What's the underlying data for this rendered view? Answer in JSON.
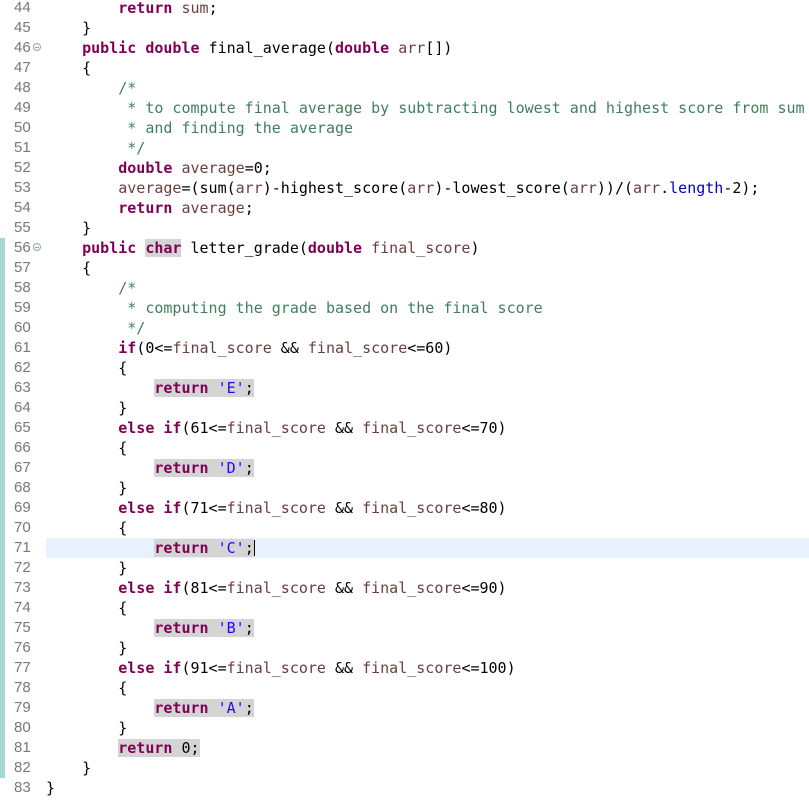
{
  "editor": {
    "lines": [
      {
        "num": "44",
        "tokens": [
          {
            "t": "        "
          },
          {
            "t": "return",
            "c": "kw"
          },
          {
            "t": " "
          },
          {
            "t": "sum",
            "c": "id"
          },
          {
            "t": ";"
          }
        ]
      },
      {
        "num": "45",
        "tokens": [
          {
            "t": "    }"
          }
        ]
      },
      {
        "num": "46",
        "fold": true,
        "tokens": [
          {
            "t": "    "
          },
          {
            "t": "public",
            "c": "kw"
          },
          {
            "t": " "
          },
          {
            "t": "double",
            "c": "kw"
          },
          {
            "t": " final_average("
          },
          {
            "t": "double",
            "c": "kw"
          },
          {
            "t": " "
          },
          {
            "t": "arr",
            "c": "id"
          },
          {
            "t": "[])"
          }
        ]
      },
      {
        "num": "47",
        "tokens": [
          {
            "t": "    {"
          }
        ]
      },
      {
        "num": "48",
        "tokens": [
          {
            "t": "        "
          },
          {
            "t": "/*",
            "c": "cmt"
          }
        ]
      },
      {
        "num": "49",
        "tokens": [
          {
            "t": "         "
          },
          {
            "t": "* to compute final average by subtracting lowest and highest score from sum",
            "c": "cmt"
          }
        ]
      },
      {
        "num": "50",
        "tokens": [
          {
            "t": "         "
          },
          {
            "t": "* and finding the average",
            "c": "cmt"
          }
        ]
      },
      {
        "num": "51",
        "tokens": [
          {
            "t": "         "
          },
          {
            "t": "*/",
            "c": "cmt"
          }
        ]
      },
      {
        "num": "52",
        "tokens": [
          {
            "t": "        "
          },
          {
            "t": "double",
            "c": "kw"
          },
          {
            "t": " "
          },
          {
            "t": "average",
            "c": "id"
          },
          {
            "t": "=0;"
          }
        ]
      },
      {
        "num": "53",
        "tokens": [
          {
            "t": "        "
          },
          {
            "t": "average",
            "c": "id"
          },
          {
            "t": "=(sum("
          },
          {
            "t": "arr",
            "c": "id"
          },
          {
            "t": ")-highest_score("
          },
          {
            "t": "arr",
            "c": "id"
          },
          {
            "t": ")-lowest_score("
          },
          {
            "t": "arr",
            "c": "id"
          },
          {
            "t": "))/("
          },
          {
            "t": "arr",
            "c": "id"
          },
          {
            "t": "."
          },
          {
            "t": "length",
            "c": "fld"
          },
          {
            "t": "-2);"
          }
        ]
      },
      {
        "num": "54",
        "tokens": [
          {
            "t": "        "
          },
          {
            "t": "return",
            "c": "kw"
          },
          {
            "t": " "
          },
          {
            "t": "average",
            "c": "id"
          },
          {
            "t": ";"
          }
        ]
      },
      {
        "num": "55",
        "tokens": [
          {
            "t": "    }"
          }
        ]
      },
      {
        "num": "56",
        "fold": true,
        "changed": true,
        "tokens": [
          {
            "t": "    "
          },
          {
            "t": "public",
            "c": "kw"
          },
          {
            "t": " "
          },
          {
            "t": "char",
            "c": "kw hl"
          },
          {
            "t": " letter_grade("
          },
          {
            "t": "double",
            "c": "kw"
          },
          {
            "t": " "
          },
          {
            "t": "final_score",
            "c": "id"
          },
          {
            "t": ")"
          }
        ]
      },
      {
        "num": "57",
        "changed": true,
        "tokens": [
          {
            "t": "    {"
          }
        ]
      },
      {
        "num": "58",
        "changed": true,
        "tokens": [
          {
            "t": "        "
          },
          {
            "t": "/*",
            "c": "cmt"
          }
        ]
      },
      {
        "num": "59",
        "changed": true,
        "tokens": [
          {
            "t": "         "
          },
          {
            "t": "* computing the grade based on the final score",
            "c": "cmt"
          }
        ]
      },
      {
        "num": "60",
        "changed": true,
        "tokens": [
          {
            "t": "         "
          },
          {
            "t": "*/",
            "c": "cmt"
          }
        ]
      },
      {
        "num": "61",
        "changed": true,
        "tokens": [
          {
            "t": "        "
          },
          {
            "t": "if",
            "c": "kw"
          },
          {
            "t": "(0<="
          },
          {
            "t": "final_score",
            "c": "id"
          },
          {
            "t": " && "
          },
          {
            "t": "final_score",
            "c": "id"
          },
          {
            "t": "<=60)"
          }
        ]
      },
      {
        "num": "62",
        "changed": true,
        "tokens": [
          {
            "t": "        {"
          }
        ]
      },
      {
        "num": "63",
        "changed": true,
        "tokens": [
          {
            "t": "            "
          },
          {
            "t": "return",
            "c": "kw hl"
          },
          {
            "t": " ",
            "c": "hl"
          },
          {
            "t": "'E'",
            "c": "str hl"
          },
          {
            "t": ";",
            "c": "hl"
          }
        ]
      },
      {
        "num": "64",
        "changed": true,
        "tokens": [
          {
            "t": "        }"
          }
        ]
      },
      {
        "num": "65",
        "changed": true,
        "tokens": [
          {
            "t": "        "
          },
          {
            "t": "else",
            "c": "kw"
          },
          {
            "t": " "
          },
          {
            "t": "if",
            "c": "kw"
          },
          {
            "t": "(61<="
          },
          {
            "t": "final_score",
            "c": "id"
          },
          {
            "t": " && "
          },
          {
            "t": "final_score",
            "c": "id"
          },
          {
            "t": "<=70)"
          }
        ]
      },
      {
        "num": "66",
        "changed": true,
        "tokens": [
          {
            "t": "        {"
          }
        ]
      },
      {
        "num": "67",
        "changed": true,
        "tokens": [
          {
            "t": "            "
          },
          {
            "t": "return",
            "c": "kw hl"
          },
          {
            "t": " ",
            "c": "hl"
          },
          {
            "t": "'D'",
            "c": "str hl"
          },
          {
            "t": ";",
            "c": "hl"
          }
        ]
      },
      {
        "num": "68",
        "changed": true,
        "tokens": [
          {
            "t": "        }"
          }
        ]
      },
      {
        "num": "69",
        "changed": true,
        "tokens": [
          {
            "t": "        "
          },
          {
            "t": "else",
            "c": "kw"
          },
          {
            "t": " "
          },
          {
            "t": "if",
            "c": "kw"
          },
          {
            "t": "(71<="
          },
          {
            "t": "final_score",
            "c": "id"
          },
          {
            "t": " && "
          },
          {
            "t": "final_score",
            "c": "id"
          },
          {
            "t": "<=80)"
          }
        ]
      },
      {
        "num": "70",
        "changed": true,
        "tokens": [
          {
            "t": "        {"
          }
        ]
      },
      {
        "num": "71",
        "changed": true,
        "current": true,
        "tokens": [
          {
            "t": "            "
          },
          {
            "t": "return",
            "c": "kw hl"
          },
          {
            "t": " ",
            "c": "hl"
          },
          {
            "t": "'C'",
            "c": "str hl"
          },
          {
            "t": ";",
            "c": "hl"
          }
        ],
        "caret": true
      },
      {
        "num": "72",
        "changed": true,
        "tokens": [
          {
            "t": "        }"
          }
        ]
      },
      {
        "num": "73",
        "changed": true,
        "tokens": [
          {
            "t": "        "
          },
          {
            "t": "else",
            "c": "kw"
          },
          {
            "t": " "
          },
          {
            "t": "if",
            "c": "kw"
          },
          {
            "t": "(81<="
          },
          {
            "t": "final_score",
            "c": "id"
          },
          {
            "t": " && "
          },
          {
            "t": "final_score",
            "c": "id"
          },
          {
            "t": "<=90)"
          }
        ]
      },
      {
        "num": "74",
        "changed": true,
        "tokens": [
          {
            "t": "        {"
          }
        ]
      },
      {
        "num": "75",
        "changed": true,
        "tokens": [
          {
            "t": "            "
          },
          {
            "t": "return",
            "c": "kw hl"
          },
          {
            "t": " ",
            "c": "hl"
          },
          {
            "t": "'B'",
            "c": "str hl"
          },
          {
            "t": ";",
            "c": "hl"
          }
        ]
      },
      {
        "num": "76",
        "changed": true,
        "tokens": [
          {
            "t": "        }"
          }
        ]
      },
      {
        "num": "77",
        "changed": true,
        "tokens": [
          {
            "t": "        "
          },
          {
            "t": "else",
            "c": "kw"
          },
          {
            "t": " "
          },
          {
            "t": "if",
            "c": "kw"
          },
          {
            "t": "(91<="
          },
          {
            "t": "final_score",
            "c": "id"
          },
          {
            "t": " && "
          },
          {
            "t": "final_score",
            "c": "id"
          },
          {
            "t": "<=100)"
          }
        ]
      },
      {
        "num": "78",
        "changed": true,
        "tokens": [
          {
            "t": "        {"
          }
        ]
      },
      {
        "num": "79",
        "changed": true,
        "tokens": [
          {
            "t": "            "
          },
          {
            "t": "return",
            "c": "kw hl"
          },
          {
            "t": " ",
            "c": "hl"
          },
          {
            "t": "'A'",
            "c": "str hl"
          },
          {
            "t": ";",
            "c": "hl"
          }
        ]
      },
      {
        "num": "80",
        "changed": true,
        "tokens": [
          {
            "t": "        }"
          }
        ]
      },
      {
        "num": "81",
        "changed": true,
        "tokens": [
          {
            "t": "        "
          },
          {
            "t": "return",
            "c": "kw hl"
          },
          {
            "t": " 0;",
            "c": "hl"
          }
        ]
      },
      {
        "num": "82",
        "changed": true,
        "tokens": [
          {
            "t": "    }"
          }
        ]
      },
      {
        "num": "83",
        "tokens": [
          {
            "t": "}"
          }
        ]
      }
    ]
  },
  "colors": {
    "keyword": "#7f0055",
    "local_variable": "#6a3e3e",
    "field": "#0000c0",
    "string": "#2a00ff",
    "comment": "#3f7f5f",
    "current_line": "#e8f2fe",
    "occurrence_highlight": "#d4d4d4",
    "change_bar": "#a6d7d2"
  }
}
